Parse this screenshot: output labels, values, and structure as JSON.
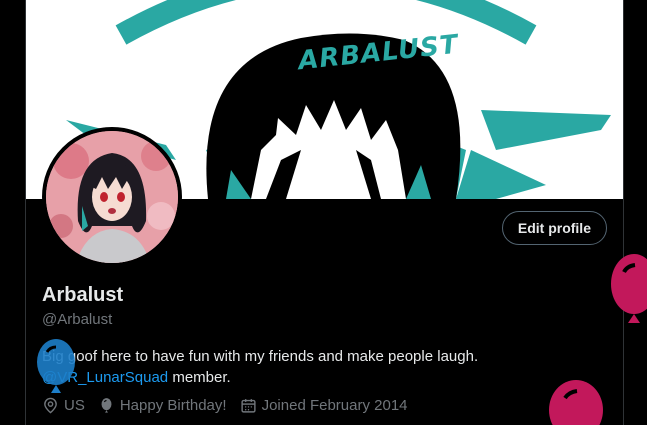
{
  "banner": {
    "logo_text": "ARBALUST",
    "colors": {
      "background": "#ffffff",
      "accent": "#2aa8a3",
      "ink": "#000000"
    }
  },
  "profile": {
    "display_name": "Arbalust",
    "handle": "@Arbalust",
    "edit_button_label": "Edit profile",
    "bio_text": "Big goof here to have fun with my friends and make people laugh.",
    "bio_mention": "@VR_LunarSquad",
    "bio_suffix": " member.",
    "location": "US",
    "birthday": "Happy Birthday!",
    "joined": "Joined February 2014"
  },
  "icons": [
    "location-pin-icon",
    "balloon-icon",
    "calendar-icon"
  ],
  "balloons": [
    {
      "color": "#1d7ec9"
    },
    {
      "color": "#c2185b"
    },
    {
      "color": "#c2185b"
    }
  ],
  "theme": {
    "text_primary": "#e7e9ea",
    "text_secondary": "#71767b",
    "link": "#1d9bf0",
    "border": "#536471"
  }
}
